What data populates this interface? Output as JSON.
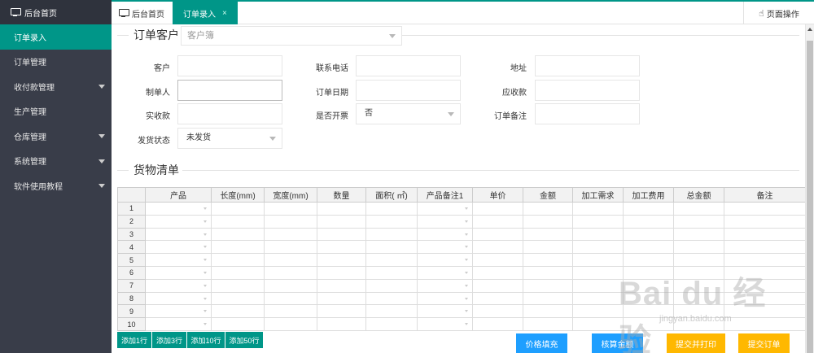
{
  "sidebar": {
    "home_label": "后台首页",
    "items": [
      {
        "label": "订单录入",
        "active": true,
        "has_caret": false
      },
      {
        "label": "订单管理",
        "active": false,
        "has_caret": false
      },
      {
        "label": "收付款管理",
        "active": false,
        "has_caret": true
      },
      {
        "label": "生产管理",
        "active": false,
        "has_caret": false
      },
      {
        "label": "仓库管理",
        "active": false,
        "has_caret": true
      },
      {
        "label": "系统管理",
        "active": false,
        "has_caret": true
      },
      {
        "label": "软件使用教程",
        "active": false,
        "has_caret": true
      }
    ]
  },
  "tabs": {
    "home_label": "后台首页",
    "current_label": "订单录入",
    "close_glyph": "×",
    "page_ops_label": "页面操作"
  },
  "customer_section": {
    "title": "订单客户",
    "select_placeholder": "客户簿"
  },
  "form": {
    "customer_label": "客户",
    "contact_phone_label": "联系电话",
    "address_label": "地址",
    "creator_label": "制单人",
    "order_date_label": "订单日期",
    "receivable_label": "应收款",
    "received_label": "实收款",
    "invoice_label": "是否开票",
    "invoice_value": "否",
    "order_note_label": "订单备注",
    "ship_status_label": "发货状态",
    "ship_status_value": "未发货"
  },
  "goods_section": {
    "title": "货物清单"
  },
  "table": {
    "columns": [
      "产品",
      "长度(mm)",
      "宽度(mm)",
      "数量",
      "面积( ㎡)",
      "产品备注1",
      "单价",
      "金额",
      "加工需求",
      "加工费用",
      "总金额",
      "备注"
    ],
    "row_numbers": [
      "1",
      "2",
      "3",
      "4",
      "5",
      "6",
      "7",
      "8",
      "9",
      "10"
    ]
  },
  "buttons": {
    "add_1": "添加1行",
    "add_3": "添加3行",
    "add_10": "添加10行",
    "add_50": "添加50行",
    "price_fill": "价格填充",
    "calc_amount": "核算金额",
    "submit_print": "提交并打印",
    "submit_order": "提交订单"
  },
  "watermark": {
    "text": "Bai du 经验",
    "sub": "jingyan.baidu.com"
  },
  "colors": {
    "accent": "#009688",
    "sidebar_bg": "#393d49",
    "blue": "#1e9fff",
    "orange": "#ffb800"
  }
}
